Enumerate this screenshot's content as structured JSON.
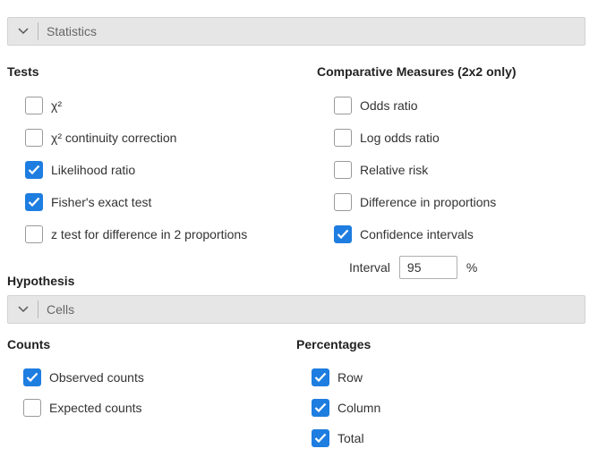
{
  "statistics_panel": {
    "title": "Statistics",
    "tests": {
      "heading": "Tests",
      "items": [
        {
          "label": "χ²",
          "checked": false
        },
        {
          "label": "χ² continuity correction",
          "checked": false
        },
        {
          "label": "Likelihood ratio",
          "checked": true
        },
        {
          "label": "Fisher's exact test",
          "checked": true
        },
        {
          "label": "z test for difference in 2 proportions",
          "checked": false
        }
      ]
    },
    "comparative": {
      "heading": "Comparative Measures (2x2 only)",
      "items": [
        {
          "label": "Odds ratio",
          "checked": false
        },
        {
          "label": "Log odds ratio",
          "checked": false
        },
        {
          "label": "Relative risk",
          "checked": false
        },
        {
          "label": "Difference in proportions",
          "checked": false
        },
        {
          "label": "Confidence intervals",
          "checked": true
        }
      ],
      "interval_label": "Interval",
      "interval_value": "95",
      "interval_unit": "%"
    },
    "hypothesis_heading": "Hypothesis"
  },
  "cells_panel": {
    "title": "Cells",
    "counts": {
      "heading": "Counts",
      "items": [
        {
          "label": "Observed counts",
          "checked": true
        },
        {
          "label": "Expected counts",
          "checked": false
        }
      ]
    },
    "percentages": {
      "heading": "Percentages",
      "items": [
        {
          "label": "Row",
          "checked": true
        },
        {
          "label": "Column",
          "checked": true
        },
        {
          "label": "Total",
          "checked": true
        }
      ]
    }
  },
  "colors": {
    "accent": "#1e7de0",
    "header_bg": "#e6e6e6"
  },
  "icons": {
    "collapse": "chevron-down-icon",
    "check": "checkmark-icon"
  }
}
